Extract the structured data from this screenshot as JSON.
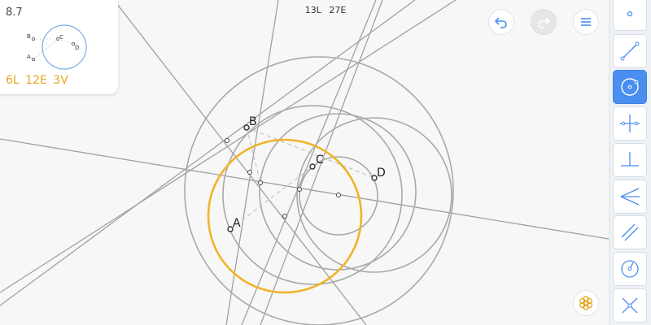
{
  "hud": {
    "lines": "13L",
    "elements": "27E"
  },
  "level_card": {
    "level": "8.7",
    "preview_labels": [
      "B",
      "C",
      "A",
      "D"
    ],
    "goal": {
      "lines": "6L",
      "elements": "12E",
      "verbs": "3V"
    }
  },
  "canvas": {
    "point_labels": [
      "A",
      "B",
      "C",
      "D"
    ]
  },
  "colors": {
    "accent": "#4a8ff0",
    "goal": "#e5a823",
    "construction": "#a0a0a0",
    "solution_circle": "#f0b429"
  },
  "top_buttons": [
    "undo-icon",
    "redo-icon",
    "menu-icon"
  ],
  "toolbar": {
    "tools": [
      "point-tool-icon",
      "line-tool-icon",
      "circle-tool-icon",
      "perpendicular-bisector-icon",
      "perpendicular-icon",
      "angle-bisector-icon",
      "parallel-icon",
      "compass-icon",
      "intersect-icon"
    ],
    "active_tool": "circle-tool-icon"
  }
}
